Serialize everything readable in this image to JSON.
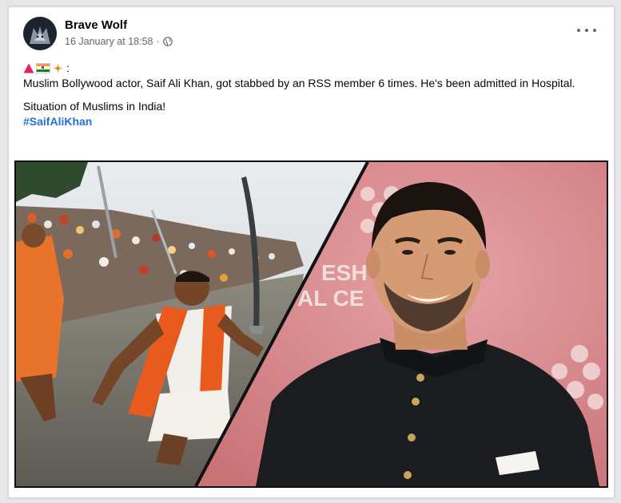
{
  "post": {
    "author_name": "Brave Wolf",
    "timestamp": "16 January at 18:58",
    "separator": "·",
    "privacy_icon": "globe-icon",
    "more_options_icon": "more-horizontal-icon",
    "emoji_prefix": [
      "warning-triangle-icon",
      "india-flag-icon",
      "sparkle-icon"
    ],
    "emoji_suffix": ":",
    "text_paragraph_1": "Muslim Bollywood actor, Saif Ali Khan, got stabbed by an RSS member 6 times. He's been admitted in Hospital.",
    "text_paragraph_2": "Situation of Muslims in India!",
    "hashtag": "#SaifAliKhan"
  },
  "image": {
    "left_panel": "crowd-procession-photo",
    "right_panel": "portrait-photo",
    "backdrop_text_line1": "ESH",
    "backdrop_text_line2": "AL CE"
  },
  "colors": {
    "link": "#216fdb",
    "secondary_text": "#65676b",
    "backdrop_pink": "#d98a8f",
    "saffron": "#f07a1f"
  }
}
